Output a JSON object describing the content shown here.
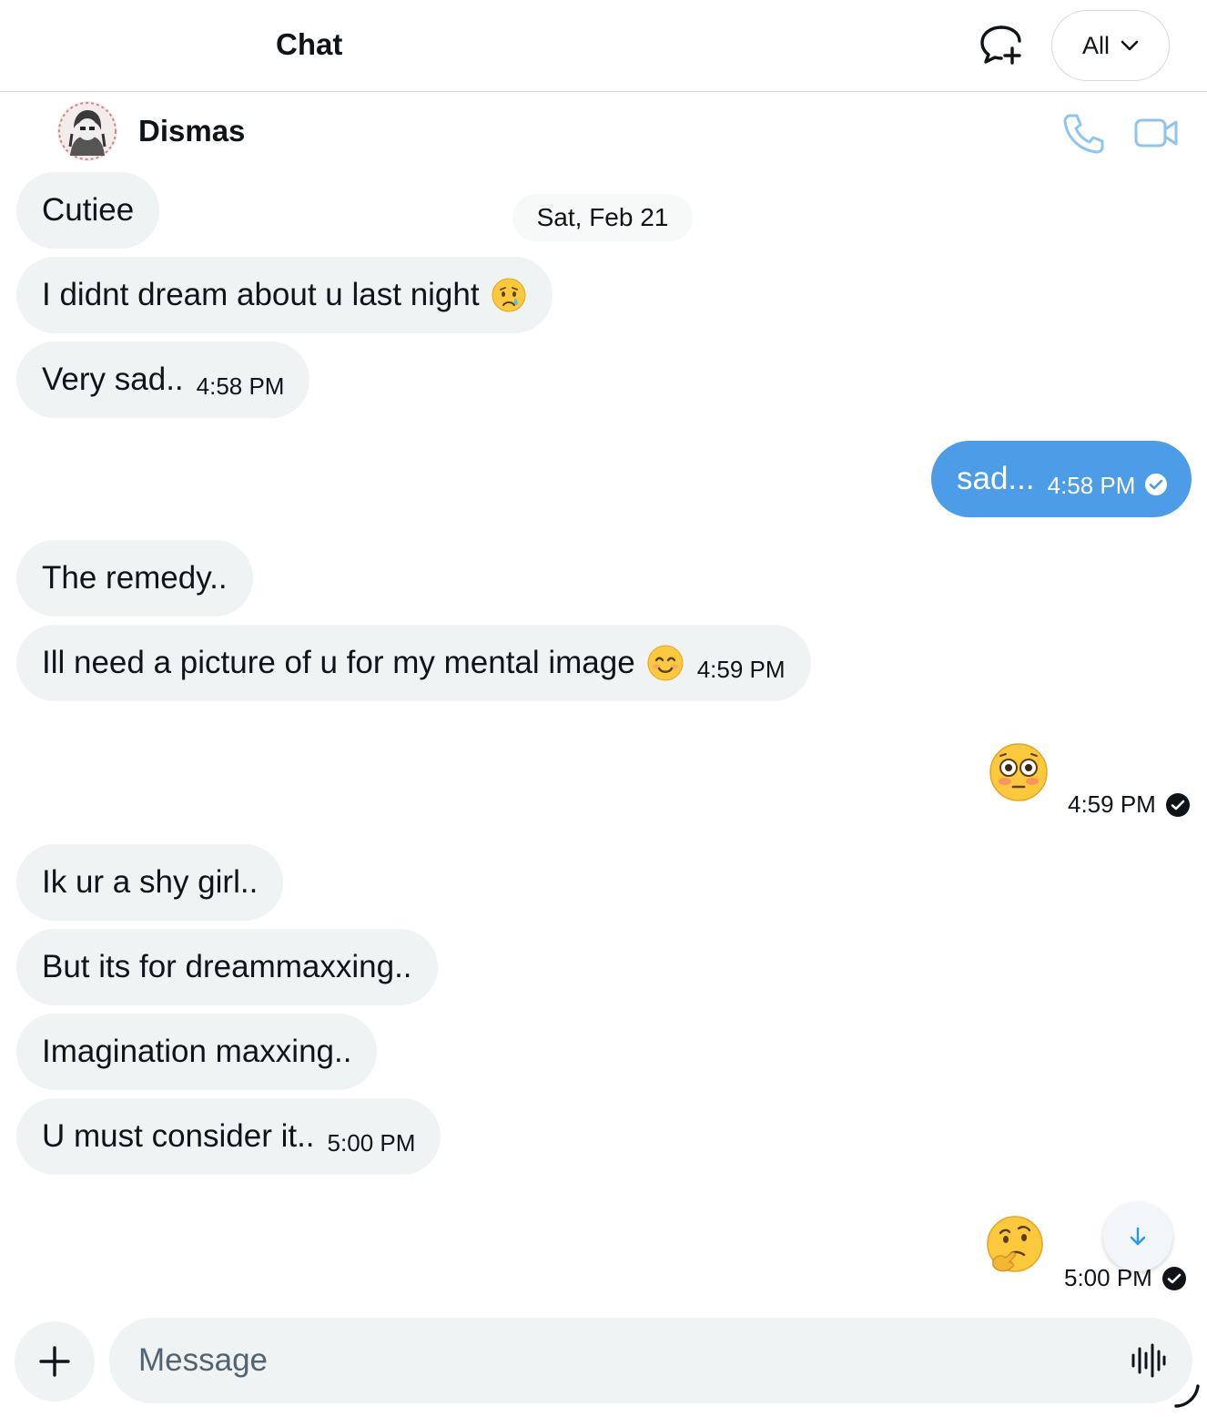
{
  "header": {
    "title": "Chat",
    "filter_label": "All"
  },
  "contact": {
    "name": "Dismas"
  },
  "date_divider": "Sat, Feb 21",
  "messages": [
    {
      "text": "Cutiee",
      "direction": "incoming"
    },
    {
      "text": "I didnt dream about u last night",
      "emoji": "crying-face",
      "direction": "incoming"
    },
    {
      "text": "Very sad..",
      "time": "4:58 PM",
      "direction": "incoming"
    },
    {
      "text": "sad...",
      "time": "4:58 PM",
      "direction": "outgoing",
      "status": "read"
    },
    {
      "text": "The remedy..",
      "direction": "incoming"
    },
    {
      "text": "Ill need a picture of u for my mental image",
      "emoji": "smiling-face",
      "time": "4:59 PM",
      "direction": "incoming"
    },
    {
      "emoji": "flushed-face",
      "time": "4:59 PM",
      "direction": "outgoing",
      "status": "read"
    },
    {
      "text": "Ik ur a shy girl..",
      "direction": "incoming"
    },
    {
      "text": "But its for dreammaxxing..",
      "direction": "incoming"
    },
    {
      "text": "Imagination maxxing..",
      "direction": "incoming"
    },
    {
      "text": "U must consider it..",
      "time": "5:00 PM",
      "direction": "incoming"
    },
    {
      "emoji": "thinking-face",
      "time": "5:00 PM",
      "direction": "outgoing",
      "status": "read"
    }
  ],
  "composer": {
    "placeholder": "Message"
  },
  "colors": {
    "accent": "#1d9bf0",
    "outgoing_bubble": "#4c9ce8",
    "incoming_bubble": "#eff3f4",
    "text": "#0f1419",
    "muted": "#536471"
  },
  "icons": [
    "new-chat-icon",
    "chevron-down-icon",
    "phone-icon",
    "video-camera-icon",
    "arrow-down-icon",
    "plus-icon",
    "voice-wave-icon",
    "check-circle-icon"
  ]
}
